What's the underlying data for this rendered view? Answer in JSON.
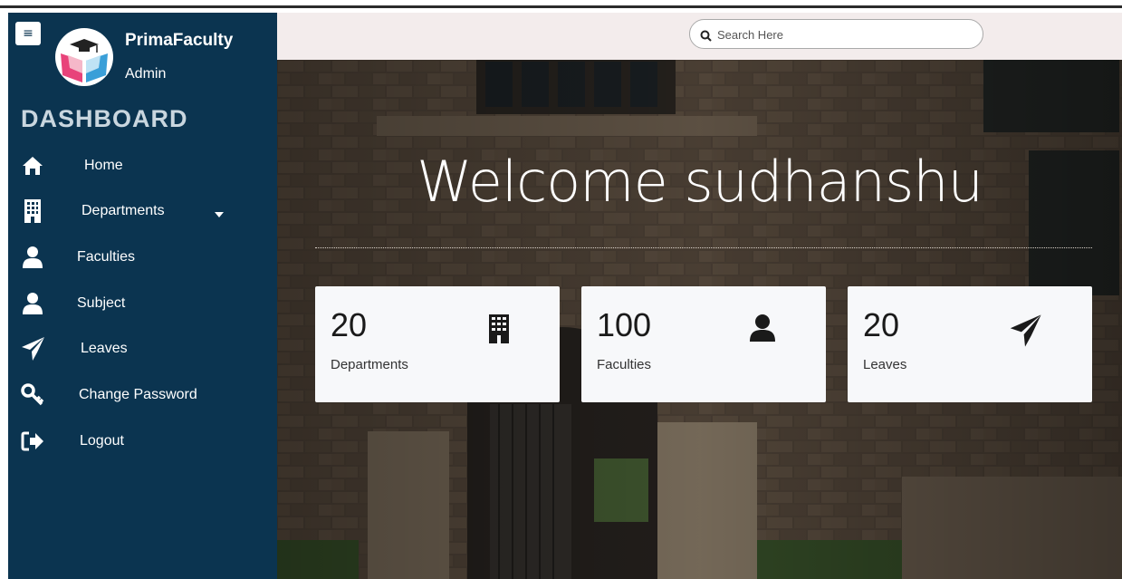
{
  "app": {
    "name": "PrimaFaculty",
    "role": "Admin"
  },
  "sidebar": {
    "heading": "DASHBOARD",
    "items": [
      {
        "label": "Home",
        "icon": "home-icon"
      },
      {
        "label": "Departments",
        "icon": "building-icon",
        "has_dropdown": true
      },
      {
        "label": "Faculties",
        "icon": "user-icon"
      },
      {
        "label": "Subject",
        "icon": "user-icon"
      },
      {
        "label": "Leaves",
        "icon": "paper-plane-icon"
      },
      {
        "label": "Change Password",
        "icon": "key-icon"
      },
      {
        "label": "Logout",
        "icon": "sign-out-icon"
      }
    ]
  },
  "search": {
    "placeholder": "Search Here"
  },
  "main": {
    "welcome": "Welcome sudhanshu"
  },
  "stats": [
    {
      "value": "20",
      "label": "Departments",
      "icon": "building-icon"
    },
    {
      "value": "100",
      "label": "Faculties",
      "icon": "user-icon"
    },
    {
      "value": "20",
      "label": "Leaves",
      "icon": "paper-plane-icon"
    }
  ],
  "colors": {
    "sidebar": "#0b3450",
    "heading": "#c9d6df",
    "card": "#f7f8fa",
    "searchbar": "#f3ecec"
  }
}
